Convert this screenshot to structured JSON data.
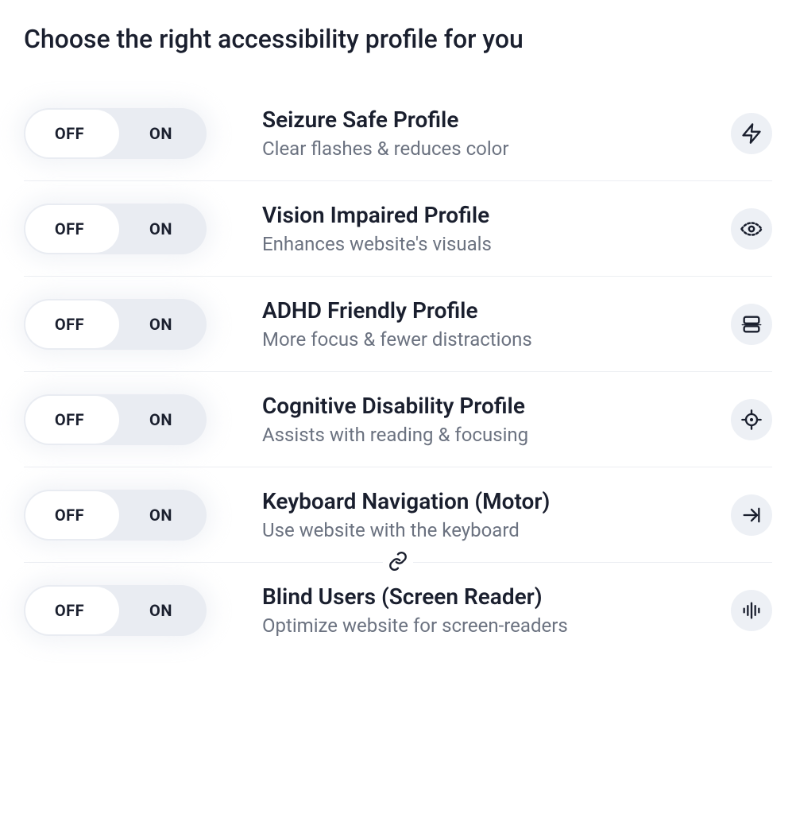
{
  "heading": "Choose the right accessibility profile for you",
  "toggle": {
    "off": "OFF",
    "on": "ON"
  },
  "profiles": [
    {
      "title": "Seizure Safe Profile",
      "desc": "Clear flashes & reduces color",
      "icon": "flash-icon"
    },
    {
      "title": "Vision Impaired Profile",
      "desc": "Enhances website's visuals",
      "icon": "eye-icon"
    },
    {
      "title": "ADHD Friendly Profile",
      "desc": "More focus & fewer distractions",
      "icon": "focus-frame-icon"
    },
    {
      "title": "Cognitive Disability Profile",
      "desc": "Assists with reading & focusing",
      "icon": "target-icon"
    },
    {
      "title": "Keyboard Navigation (Motor)",
      "desc": "Use website with the keyboard",
      "icon": "arrow-right-icon",
      "link_below": true
    },
    {
      "title": "Blind Users (Screen Reader)",
      "desc": "Optimize website for screen-readers",
      "icon": "soundwave-icon"
    }
  ]
}
